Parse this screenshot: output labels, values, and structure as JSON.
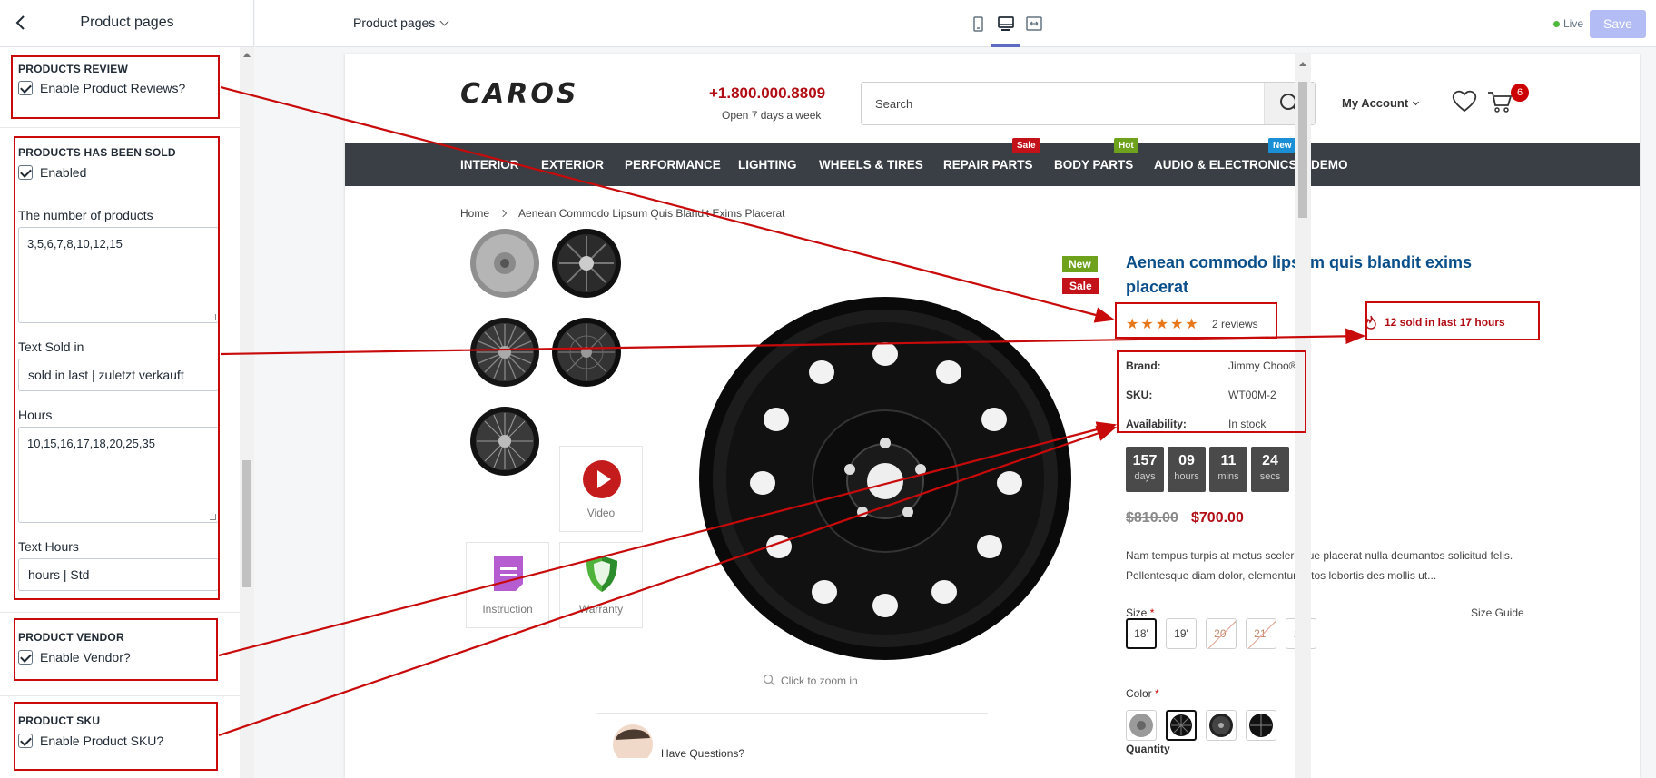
{
  "editor": {
    "title": "Product pages",
    "sections": {
      "review": {
        "title": "PRODUCTS REVIEW",
        "checkbox": "Enable Product Reviews?"
      },
      "sold": {
        "title": "PRODUCTS HAS BEEN SOLD",
        "checkbox": "Enabled",
        "number_label": "The number of products",
        "number_value": "3,5,6,7,8,10,12,15",
        "text_sold_label": "Text Sold in",
        "text_sold_value": "sold in last | zuletzt verkauft",
        "hours_label": "Hours",
        "hours_value": "10,15,16,17,18,20,25,35",
        "text_hours_label": "Text Hours",
        "text_hours_value": "hours | Std"
      },
      "vendor": {
        "title": "PRODUCT VENDOR",
        "checkbox": "Enable Vendor?"
      },
      "sku": {
        "title": "PRODUCT SKU",
        "checkbox": "Enable Product SKU?"
      }
    }
  },
  "topbar": {
    "page_select": "Product pages",
    "live": "Live",
    "save": "Save"
  },
  "store": {
    "logo": "CAROS",
    "phone": "+1.800.000.8809",
    "phone_sub": "Open 7 days a week",
    "search_placeholder": "Search",
    "account": "My Account",
    "cart_count": "6",
    "nav": [
      "INTERIOR",
      "EXTERIOR",
      "PERFORMANCE",
      "LIGHTING",
      "WHEELS & TIRES",
      "REPAIR PARTS",
      "BODY PARTS",
      "AUDIO & ELECTRONICS",
      "DEMO"
    ],
    "nav_tags": {
      "sale": "Sale",
      "hot": "Hot",
      "new": "New"
    },
    "breadcrumb": {
      "home": "Home",
      "current": "Aenean Commodo Lipsum Quis Blandit Exims Placerat"
    },
    "thumbs": {
      "video": "Video",
      "instruction": "Instruction",
      "warranty": "Warranty"
    },
    "badges": {
      "new": "New",
      "sale": "Sale"
    },
    "zoom_hint": "Click to zoom in",
    "have_questions": "Have Questions?",
    "product": {
      "title": "Aenean commodo lipsum quis blandit exims placerat",
      "rating": 5,
      "reviews": "2 reviews",
      "sold_text": "12 sold in last 17 hours",
      "brand_label": "Brand:",
      "brand": "Jimmy Choo®",
      "sku_label": "SKU:",
      "sku": "WT00M-2",
      "avail_label": "Availability:",
      "avail": "In stock",
      "countdown": [
        {
          "n": "157",
          "u": "days"
        },
        {
          "n": "09",
          "u": "hours"
        },
        {
          "n": "11",
          "u": "mins"
        },
        {
          "n": "24",
          "u": "secs"
        }
      ],
      "old_price": "$810.00",
      "price": "$700.00",
      "description": "Nam tempus turpis at metus scelerisque placerat nulla deumantos solicitud felis. Pellentesque diam dolor, elementum etos lobortis des mollis ut...",
      "size_label": "Size",
      "size_guide": "Size Guide",
      "sizes": [
        "18'",
        "19'",
        "20'",
        "21'",
        "22'"
      ],
      "color_label": "Color",
      "quantity_label": "Quantity"
    }
  },
  "colors": {
    "annotation": "#c80a0a",
    "accent": "#5c6ac4",
    "price": "#b20c14",
    "title": "#0b4f8a",
    "nav_bg": "#3a3f45"
  }
}
